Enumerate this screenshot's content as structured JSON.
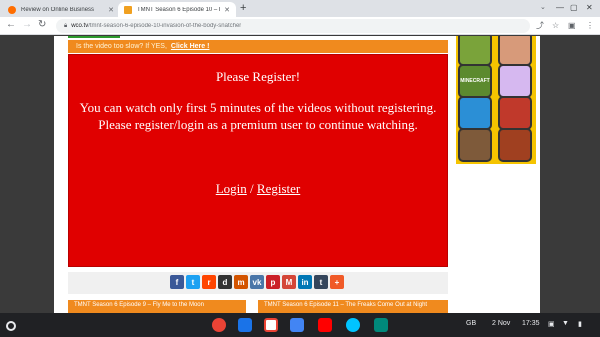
{
  "browser": {
    "tabs": [
      {
        "title": "Review on Online Business",
        "favicon_color": "#ff6d00",
        "active": false
      },
      {
        "title": "TMNT Season 6 Episode 10 – In",
        "favicon_color": "#f0a020",
        "active": true
      }
    ],
    "url_domain": "wco.tv",
    "url_path": "/tmnt-season-6-episode-10-invasion-of-the-body-snatcher"
  },
  "page": {
    "slow_text": "Is the video too slow? If YES,",
    "slow_link": "Click Here !",
    "register_title": "Please Register!",
    "register_message": "You can watch only first 5 minutes of the videos without registering. Please register/login as a premium user to continue watching.",
    "login_link": "Login",
    "separator": "/",
    "register_link": "Register",
    "share_icons": [
      {
        "glyph": "f",
        "color": "#3b5998"
      },
      {
        "glyph": "t",
        "color": "#1da1f2"
      },
      {
        "glyph": "r",
        "color": "#ff4500"
      },
      {
        "glyph": "d",
        "color": "#333333"
      },
      {
        "glyph": "m",
        "color": "#d35400"
      },
      {
        "glyph": "vk",
        "color": "#4a76a8"
      },
      {
        "glyph": "p",
        "color": "#cb2027"
      },
      {
        "glyph": "M",
        "color": "#d44638"
      },
      {
        "glyph": "in",
        "color": "#0077b5"
      },
      {
        "glyph": "t",
        "color": "#35465c"
      },
      {
        "glyph": "+",
        "color": "#f05a28"
      }
    ],
    "prev_episode": "TMNT Season 6 Episode 9 – Fly Me to the Moon",
    "next_episode": "TMNT Season 6 Episode 11 – The Freaks Come Out at Night",
    "sidebar_games": [
      {
        "label": "",
        "color": "#7aa33a"
      },
      {
        "label": "",
        "color": "#d79a7a"
      },
      {
        "label": "MINECRAFT",
        "color": "#5c8a2e"
      },
      {
        "label": "",
        "color": "#d6b8f0"
      },
      {
        "label": "",
        "color": "#2b8fd6"
      },
      {
        "label": "",
        "color": "#c0392b"
      },
      {
        "label": "",
        "color": "#7e5a3a"
      },
      {
        "label": "",
        "color": "#a04020"
      }
    ]
  },
  "shelf": {
    "apps": [
      {
        "name": "chrome",
        "color": "#ea4335"
      },
      {
        "name": "files",
        "color": "#1a73e8"
      },
      {
        "name": "gmail",
        "color": "#ffffff"
      },
      {
        "name": "docs",
        "color": "#4285f4"
      },
      {
        "name": "youtube",
        "color": "#ff0000"
      },
      {
        "name": "play-store",
        "color": "#00c4ff"
      },
      {
        "name": "meet",
        "color": "#00897b"
      }
    ],
    "keyboard_layout": "GB",
    "date": "2 Nov",
    "time": "17:35"
  }
}
